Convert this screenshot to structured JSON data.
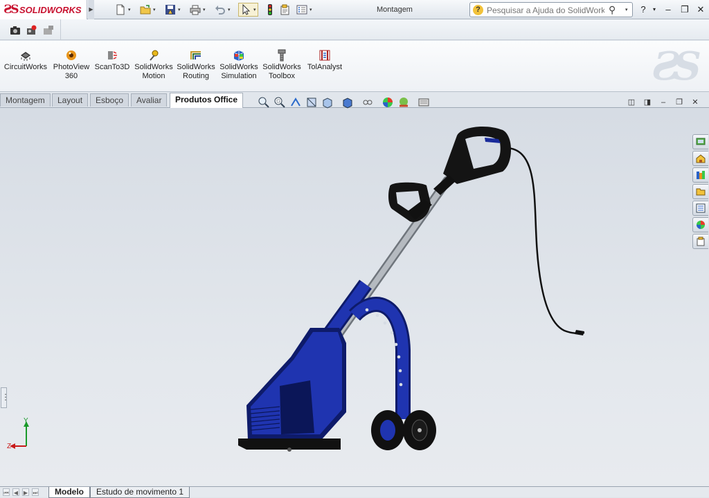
{
  "app": {
    "brand": "SOLIDWORKS",
    "window_title": "Montagem"
  },
  "help_search": {
    "placeholder": "Pesquisar a Ajuda do SolidWorks"
  },
  "command_manager": {
    "items": [
      {
        "line1": "CircuitWorks",
        "line2": ""
      },
      {
        "line1": "PhotoView",
        "line2": "360"
      },
      {
        "line1": "ScanTo3D",
        "line2": ""
      },
      {
        "line1": "SolidWorks",
        "line2": "Motion"
      },
      {
        "line1": "SolidWorks",
        "line2": "Routing"
      },
      {
        "line1": "SolidWorks",
        "line2": "Simulation"
      },
      {
        "line1": "SolidWorks",
        "line2": "Toolbox"
      },
      {
        "line1": "TolAnalyst",
        "line2": ""
      }
    ]
  },
  "tabs": [
    {
      "label": "Montagem"
    },
    {
      "label": "Layout"
    },
    {
      "label": "Esboço"
    },
    {
      "label": "Avaliar"
    },
    {
      "label": "Produtos Office",
      "active": true
    }
  ],
  "triad": {
    "y_label": "Y",
    "z_label": "Z"
  },
  "bottom_tabs": [
    {
      "label": "Modelo",
      "active": true
    },
    {
      "label": "Estudo de movimento 1"
    }
  ],
  "colors": {
    "brand_red": "#c8102e",
    "model_blue": "#1a2b9a",
    "model_black": "#111111",
    "model_grey": "#9aa0a6"
  },
  "icons": {
    "new": "new-document-icon",
    "open": "open-folder-icon",
    "save": "save-icon",
    "print": "print-icon",
    "undo": "undo-icon",
    "select": "select-arrow-icon",
    "rebuild": "traffic-light-icon",
    "options": "options-icon"
  }
}
